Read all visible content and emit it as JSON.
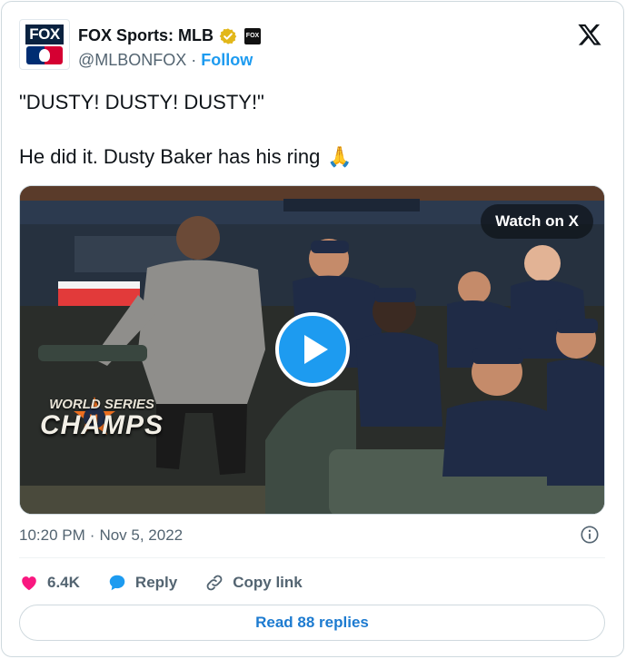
{
  "author": {
    "display_name": "FOX Sports: MLB",
    "handle": "@MLBONFOX",
    "separator": "·",
    "follow_label": "Follow",
    "avatar_text": "FOX",
    "affiliate_badge_text": "FOX"
  },
  "tweet": {
    "line1": "\"DUSTY! DUSTY! DUSTY!\"",
    "line2": "He did it. Dusty Baker has his ring",
    "emoji": "🙏"
  },
  "media": {
    "watch_label": "Watch on X",
    "overlay_world_series": "WORLD SERIES",
    "overlay_champs": "CHAMPS",
    "banner_text": "WORLD SERIES 2022"
  },
  "meta": {
    "time": "10:20 PM",
    "separator": "·",
    "date": "Nov 5, 2022"
  },
  "actions": {
    "likes": "6.4K",
    "reply_label": "Reply",
    "copy_link_label": "Copy link"
  },
  "footer": {
    "read_replies_label": "Read 88 replies"
  },
  "colors": {
    "accent": "#1d9bf0",
    "link": "#1d7bd0",
    "like": "#f91880",
    "muted": "#536471",
    "verified": "#e2b719"
  }
}
